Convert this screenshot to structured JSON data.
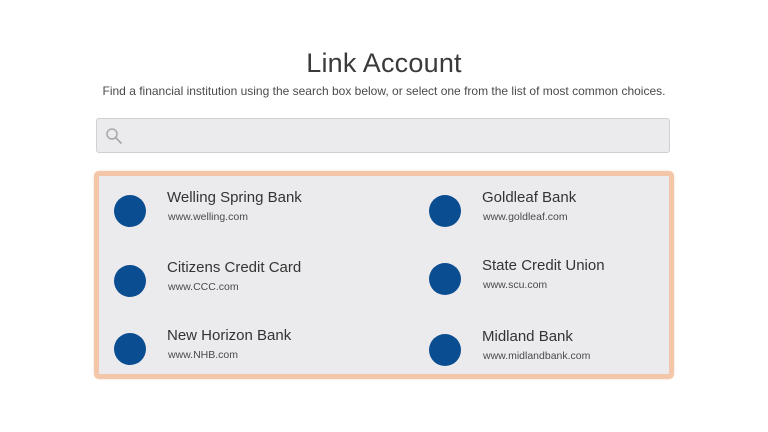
{
  "header": {
    "title": "Link Account",
    "subtitle": "Find a financial institution using the search box below, or select one from the list of most common choices."
  },
  "search": {
    "placeholder": "",
    "value": "",
    "icon": "search-icon"
  },
  "colors": {
    "logo": "#0b4d91",
    "panel_border": "#f3c6a9",
    "panel_background": "#ebebee"
  },
  "banks": [
    {
      "name": "Welling Spring Bank",
      "url": "www.welling.com"
    },
    {
      "name": "Goldleaf Bank",
      "url": "www.goldleaf.com"
    },
    {
      "name": "Citizens Credit Card",
      "url": "www.CCC.com"
    },
    {
      "name": "State Credit Union",
      "url": "www.scu.com"
    },
    {
      "name": "New Horizon Bank",
      "url": "www.NHB.com"
    },
    {
      "name": "Midland Bank",
      "url": "www.midlandbank.com"
    }
  ]
}
